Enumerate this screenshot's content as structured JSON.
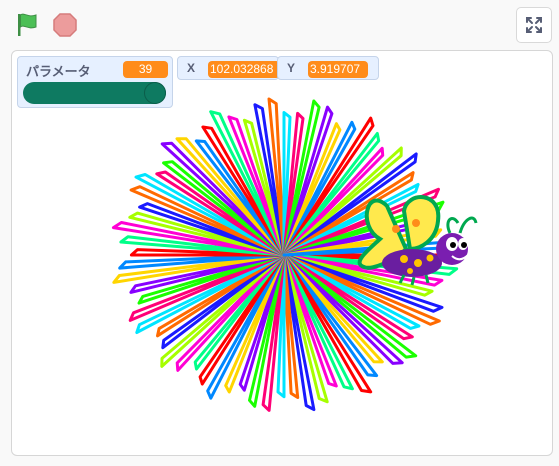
{
  "toolbar": {
    "green_flag_icon": "green-flag-icon",
    "stop_icon": "stop-icon",
    "fullscreen_icon": "fullscreen-icon"
  },
  "monitors": {
    "parameter": {
      "label": "パラメータ",
      "value": "39",
      "slider_fraction": 1.0
    },
    "x": {
      "label": "X",
      "value": "102.032868"
    },
    "y": {
      "label": "Y",
      "value": "3.919707"
    }
  },
  "stage": {
    "sprite": "butterfly",
    "pattern": "radial rainbow star",
    "colors": {
      "accent": "#ff8c1a",
      "slider": "#0e7a61",
      "flag": "#4cbf56",
      "stop": "#ec9c9c"
    }
  }
}
